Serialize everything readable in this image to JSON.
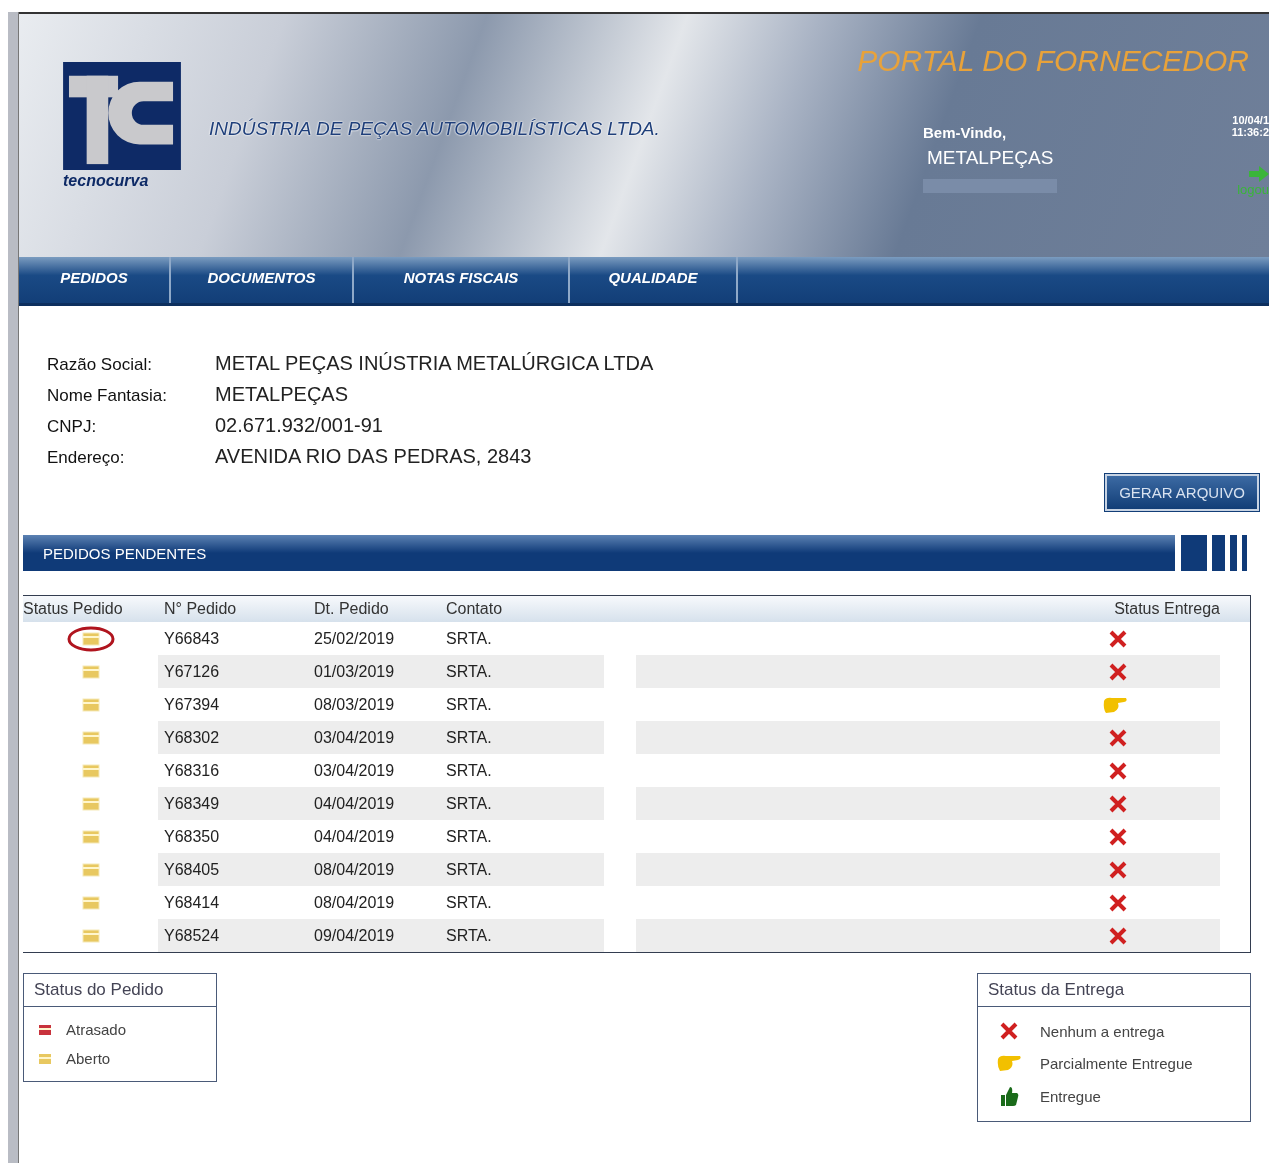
{
  "header": {
    "logo_text": "tecnocurva",
    "company": "INDÚSTRIA DE PEÇAS AUTOMOBILÍSTICAS LTDA.",
    "portal_title": "PORTAL DO FORNECEDOR",
    "welcome": "Bem-Vindo,",
    "user": "METALPEÇAS",
    "date": "10/04/1",
    "time": "11:36:2",
    "logout": "logou"
  },
  "nav": [
    {
      "label": "PEDIDOS"
    },
    {
      "label": "DOCUMENTOS"
    },
    {
      "label": "NOTAS FISCAIS"
    },
    {
      "label": "QUALIDADE"
    }
  ],
  "supplier": [
    {
      "label": "Razão Social:",
      "value": "METAL PEÇAS INÚSTRIA METALÚRGICA LTDA"
    },
    {
      "label": "Nome Fantasia:",
      "value": "METALPEÇAS"
    },
    {
      "label": "CNPJ:",
      "value": "02.671.932/001-91"
    },
    {
      "label": "Endereço:",
      "value": "AVENIDA RIO DAS PEDRAS, 2843"
    }
  ],
  "export_button": "GERAR ARQUIVO",
  "section_title": "PEDIDOS PENDENTES",
  "table": {
    "columns": [
      "Status Pedido",
      "N° Pedido",
      "Dt. Pedido",
      "Contato",
      "Status Entrega"
    ],
    "rows": [
      {
        "status": {
          "kind": "aberto"
        },
        "circled": true,
        "number": "Y66843",
        "date": "25/02/2019",
        "contact": "SRTA.",
        "delivery": {
          "kind": "none"
        }
      },
      {
        "status": {
          "kind": "aberto"
        },
        "circled": false,
        "number": "Y67126",
        "date": "01/03/2019",
        "contact": "SRTA.",
        "delivery": {
          "kind": "none"
        }
      },
      {
        "status": {
          "kind": "aberto"
        },
        "circled": false,
        "number": "Y67394",
        "date": "08/03/2019",
        "contact": "SRTA.",
        "delivery": {
          "kind": "partial"
        }
      },
      {
        "status": {
          "kind": "aberto"
        },
        "circled": false,
        "number": "Y68302",
        "date": "03/04/2019",
        "contact": "SRTA.",
        "delivery": {
          "kind": "none"
        }
      },
      {
        "status": {
          "kind": "aberto"
        },
        "circled": false,
        "number": "Y68316",
        "date": "03/04/2019",
        "contact": "SRTA.",
        "delivery": {
          "kind": "none"
        }
      },
      {
        "status": {
          "kind": "aberto"
        },
        "circled": false,
        "number": "Y68349",
        "date": "04/04/2019",
        "contact": "SRTA.",
        "delivery": {
          "kind": "none"
        }
      },
      {
        "status": {
          "kind": "aberto"
        },
        "circled": false,
        "number": "Y68350",
        "date": "04/04/2019",
        "contact": "SRTA.",
        "delivery": {
          "kind": "none"
        }
      },
      {
        "status": {
          "kind": "aberto"
        },
        "circled": false,
        "number": "Y68405",
        "date": "08/04/2019",
        "contact": "SRTA.",
        "delivery": {
          "kind": "none"
        }
      },
      {
        "status": {
          "kind": "aberto"
        },
        "circled": false,
        "number": "Y68414",
        "date": "08/04/2019",
        "contact": "SRTA.",
        "delivery": {
          "kind": "none"
        }
      },
      {
        "status": {
          "kind": "aberto"
        },
        "circled": false,
        "number": "Y68524",
        "date": "09/04/2019",
        "contact": "SRTA.",
        "delivery": {
          "kind": "none"
        }
      }
    ]
  },
  "legend_order": {
    "title": "Status do Pedido",
    "items": [
      {
        "kind": "atrasado",
        "label": "Atrasado"
      },
      {
        "kind": "aberto",
        "label": "Aberto"
      }
    ]
  },
  "legend_delivery": {
    "title": "Status da Entrega",
    "items": [
      {
        "kind": "none",
        "label": "Nenhum a entrega"
      },
      {
        "kind": "partial",
        "label": "Parcialmente Entregue"
      },
      {
        "kind": "delivered",
        "label": "Entregue"
      }
    ]
  }
}
